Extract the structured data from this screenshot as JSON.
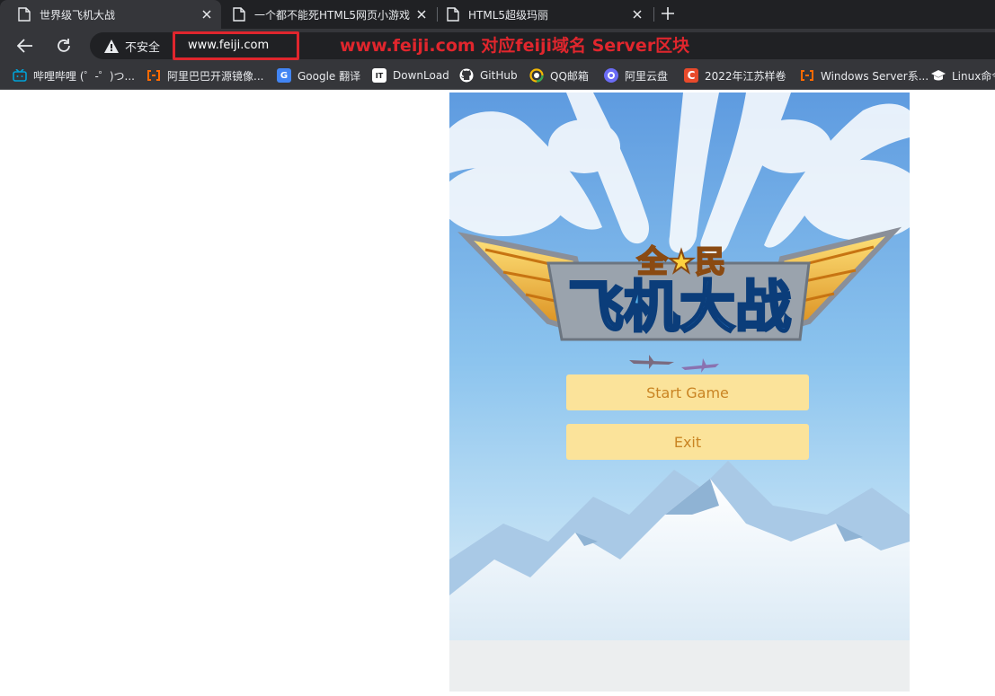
{
  "tabs": [
    {
      "title": "世界级飞机大战",
      "active": true
    },
    {
      "title": "一个都不能死HTML5网页小游戏",
      "active": false
    },
    {
      "title": "HTML5超级玛丽",
      "active": false
    }
  ],
  "toolbar": {
    "security_label": "不安全",
    "url": "www.feiji.com",
    "annotation": "www.feiji.com 对应feiji域名 Server区块",
    "annotation_color": "#e0262d"
  },
  "bookmarks": [
    {
      "label": "哔哩哔哩 (゜-゜)つ...",
      "icon": "bilibili-icon",
      "color": "#00a1d6"
    },
    {
      "label": "阿里巴巴开源镜像...",
      "icon": "aliyun-icon",
      "color": "#ff6a00"
    },
    {
      "label": "Google 翻译",
      "icon": "google-translate-icon",
      "color": "#4285f4"
    },
    {
      "label": "DownLoad",
      "icon": "download-icon",
      "color": "#ffffff"
    },
    {
      "label": "GitHub",
      "icon": "github-icon",
      "color": "#ffffff"
    },
    {
      "label": "QQ邮箱",
      "icon": "qq-mail-icon",
      "color": "#f2b705"
    },
    {
      "label": "阿里云盘",
      "icon": "aliyun-drive-icon",
      "color": "#6b6cf6"
    },
    {
      "label": "2022年江苏样卷",
      "icon": "c-icon",
      "color": "#e84a2b"
    },
    {
      "label": "Windows Server系...",
      "icon": "aliyun-icon",
      "color": "#ff6a00"
    },
    {
      "label": "Linux命令",
      "icon": "graduation-cap-icon",
      "color": "#ffffff"
    }
  ],
  "game": {
    "logo_top": "全★民",
    "logo_main": "飞机大战",
    "start_label": "Start Game",
    "exit_label": "Exit"
  }
}
